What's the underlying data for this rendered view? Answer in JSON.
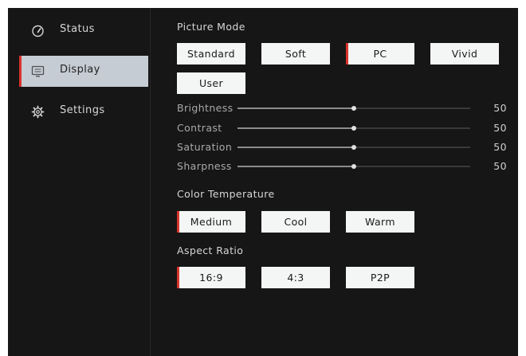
{
  "sidebar": {
    "items": [
      {
        "label": "Status",
        "icon": "gauge-icon",
        "active": false
      },
      {
        "label": "Display",
        "icon": "monitor-icon",
        "active": true
      },
      {
        "label": "Settings",
        "icon": "gear-icon",
        "active": false
      }
    ]
  },
  "picture_mode": {
    "title": "Picture Mode",
    "options": [
      "Standard",
      "Soft",
      "PC",
      "Vivid",
      "User"
    ],
    "selected": "PC"
  },
  "sliders": [
    {
      "label": "Brightness",
      "value": "50",
      "level": 0.5
    },
    {
      "label": "Contrast",
      "value": "50",
      "level": 0.5
    },
    {
      "label": "Saturation",
      "value": "50",
      "level": 0.5
    },
    {
      "label": "Sharpness",
      "value": "50",
      "level": 0.5
    }
  ],
  "color_temperature": {
    "title": "Color Temperature",
    "options": [
      "Medium",
      "Cool",
      "Warm"
    ],
    "selected": "Medium"
  },
  "aspect_ratio": {
    "title": "Aspect Ratio",
    "options": [
      "16:9",
      "4:3",
      "P2P"
    ],
    "selected": "16:9"
  },
  "colors": {
    "background": "#161616",
    "accent": "#d8342c",
    "active_nav": "#c5ccd3",
    "option_bg": "#f4f5f5"
  }
}
